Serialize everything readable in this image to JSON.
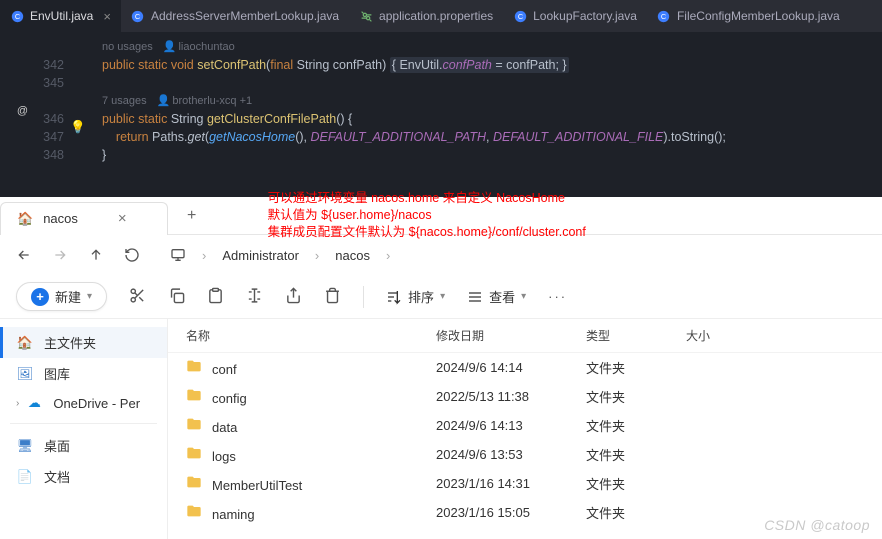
{
  "ide": {
    "tabs": [
      {
        "label": "EnvUtil.java",
        "active": true,
        "kind": "java"
      },
      {
        "label": "AddressServerMemberLookup.java",
        "active": false,
        "kind": "java"
      },
      {
        "label": "application.properties",
        "active": false,
        "kind": "prop"
      },
      {
        "label": "LookupFactory.java",
        "active": false,
        "kind": "java"
      },
      {
        "label": "FileConfigMemberLookup.java",
        "active": false,
        "kind": "java"
      }
    ],
    "gutter": {
      "lines": [
        "",
        "342",
        "345",
        "",
        "346",
        "347",
        "348"
      ],
      "sep": "@",
      "bulb": "💡"
    },
    "meta1": {
      "usage": "no usages",
      "author": "liaochuntao"
    },
    "meta2": {
      "usage": "7 usages",
      "author": "brotherlu-xcq +1"
    },
    "line_342": {
      "kw_public": "public",
      "kw_static": "static",
      "kw_void": "void",
      "name": "setConfPath",
      "paren": "(",
      "kw_final": "final",
      "type": "String",
      "arg": "confPath",
      "paren2": ")",
      "br1": "{",
      "cls": "EnvUtil",
      "dot": ".",
      "field": "confPath",
      "eq": " = confPath; ",
      "br2": "}"
    },
    "line_346": {
      "kw_public": "public",
      "kw_static": "static",
      "type": "String",
      "name": "getClusterConfFilePath",
      "paren": "() {",
      "close": "}"
    },
    "line_347": {
      "kw_return": "return",
      "cls": "Paths",
      "dot": ".",
      "m": "get",
      "open": "(",
      "inner": "getNacosHome",
      "innerp": "()",
      "c1": ", ",
      "a1": "DEFAULT_ADDITIONAL_PATH",
      "c2": ", ",
      "a2": "DEFAULT_ADDITIONAL_FILE",
      "close": ").toString();"
    }
  },
  "explorer": {
    "tab": "nacos",
    "tab_close": "×",
    "tab_add": "+",
    "annot": {
      "l1": "可以通过环境变量 nacos.home 来自定义 NacosHome",
      "l2": "默认值为 ${user.home}/nacos",
      "l3": "集群成员配置文件默认为 ${nacos.home}/conf/cluster.conf"
    },
    "crumbs": [
      "Administrator",
      "nacos"
    ],
    "crumb_sep": "›",
    "new_btn": "新建",
    "sort_btn": "排序",
    "view_btn": "查看",
    "more": "···",
    "side": {
      "home": "主文件夹",
      "gallery": "图库",
      "onedrive": "OneDrive - Per",
      "desktop": "桌面",
      "docs": "文档"
    },
    "cols": {
      "name": "名称",
      "date": "修改日期",
      "type": "类型",
      "size": "大小"
    },
    "rows": [
      {
        "name": "conf",
        "date": "2024/9/6 14:14",
        "type": "文件夹",
        "size": ""
      },
      {
        "name": "config",
        "date": "2022/5/13 11:38",
        "type": "文件夹",
        "size": ""
      },
      {
        "name": "data",
        "date": "2024/9/6 14:13",
        "type": "文件夹",
        "size": ""
      },
      {
        "name": "logs",
        "date": "2024/9/6 13:53",
        "type": "文件夹",
        "size": ""
      },
      {
        "name": "MemberUtilTest",
        "date": "2023/1/16 14:31",
        "type": "文件夹",
        "size": ""
      },
      {
        "name": "naming",
        "date": "2023/1/16 15:05",
        "type": "文件夹",
        "size": ""
      }
    ],
    "watermark": "CSDN @catoop"
  }
}
